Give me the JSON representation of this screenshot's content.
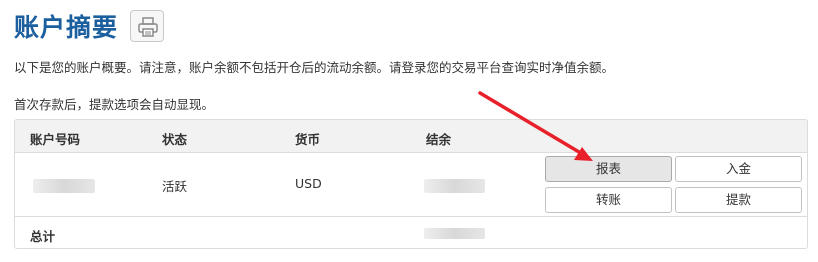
{
  "page": {
    "title": "账户摘要",
    "print_icon": "printer-icon",
    "notice": "以下是您的账户概要。请注意，账户余额不包括开仓后的流动余额。请登录您的交易平台查询实时净值余额。",
    "deposit_notice": "首次存款后，提款选项会自动显现。"
  },
  "table": {
    "headers": [
      "账户号码",
      "状态",
      "货币",
      "结余"
    ],
    "rows": [
      {
        "status": "活跃",
        "currency": "USD"
      }
    ],
    "total_label": "总计",
    "actions": {
      "report": "报表",
      "deposit": "入金",
      "transfer": "转账",
      "withdraw": "提款"
    }
  },
  "colors": {
    "title": "#1c5f9e",
    "arrow": "#e8202a",
    "header_bg": "#f2f2f2"
  }
}
